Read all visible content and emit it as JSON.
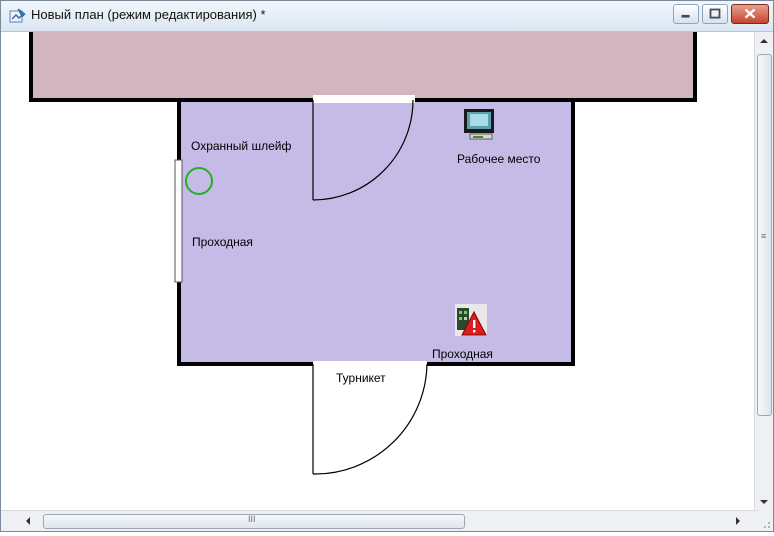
{
  "window": {
    "title": "Новый план (режим редактирования) *",
    "accent": "#c0432b"
  },
  "caption_buttons": [
    {
      "name": "minimize-button",
      "icon": "minimize-icon"
    },
    {
      "name": "maximize-button",
      "icon": "maximize-icon"
    },
    {
      "name": "close-button",
      "icon": "close-icon"
    }
  ],
  "plan": {
    "colors": {
      "top_corridor": "#d2b6bf",
      "room": "#c6bbe7",
      "walls": "#000000",
      "sensor_ring": "#22b022"
    },
    "labels": {
      "security_loop": "Охранный шлейф",
      "workstation": "Рабочее место",
      "passage_left": "Проходная",
      "passage_device": "Проходная",
      "turnstile": "Турникет"
    },
    "objects": [
      {
        "name": "workstation-icon",
        "icon": "computer-icon"
      },
      {
        "name": "access-controller-icon",
        "icon": "alarm-controller-icon"
      },
      {
        "name": "security-loop-sensor",
        "icon": "circle-sensor-icon"
      }
    ]
  },
  "scrollbars": {
    "vertical": {
      "grip": "≡"
    },
    "horizontal": {
      "grip": "III"
    }
  }
}
